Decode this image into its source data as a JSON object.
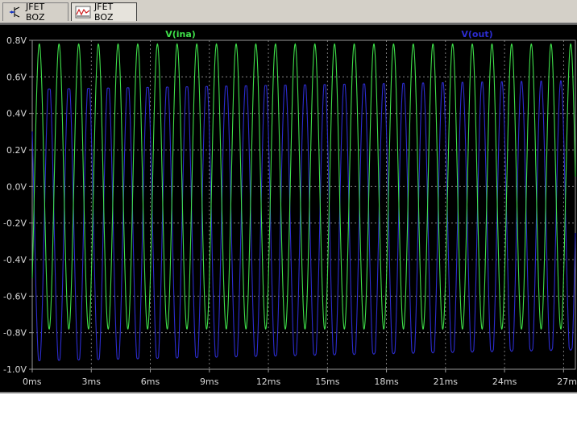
{
  "tabs": [
    {
      "label": "JFET BOZ",
      "icon": "schematic-icon"
    },
    {
      "label": "JFET BOZ",
      "icon": "waveform-icon"
    }
  ],
  "colors": {
    "background": "#000000",
    "grid": "#9a9a9a",
    "axis_text": "#d8d8d8",
    "tab_bg": "#d4d0c8"
  },
  "chart_data": {
    "type": "line",
    "x_unit": "ms",
    "y_unit": "V",
    "xlim": [
      0,
      27.6
    ],
    "ylim": [
      -1.0,
      0.8
    ],
    "x_ticks": [
      0,
      3,
      6,
      9,
      12,
      15,
      18,
      21,
      24,
      27
    ],
    "x_tick_labels": [
      "0ms",
      "3ms",
      "6ms",
      "9ms",
      "12ms",
      "15ms",
      "18ms",
      "21ms",
      "24ms",
      "27m"
    ],
    "y_ticks": [
      0.8,
      0.6,
      0.4,
      0.2,
      0.0,
      -0.2,
      -0.4,
      -0.6,
      -0.8,
      -1.0
    ],
    "y_tick_labels": [
      "0.8V",
      "0.6V",
      "0.4V",
      "0.2V",
      "0.0V",
      "-0.2V",
      "-0.4V",
      "-0.6V",
      "-0.8V",
      "-1.0V"
    ],
    "grid": true,
    "series": [
      {
        "name": "V(ina)",
        "color": "#3fe04a",
        "waveform": "sine",
        "frequency_hz": 1000,
        "amplitude_v": 0.78,
        "offset_v": 0.0,
        "start_phase_deg": -40
      },
      {
        "name": "V(out)",
        "color": "#2c2cd0",
        "waveform": "clipped-sine",
        "frequency_hz": 1000,
        "offset_v": -0.2,
        "amplitude_v": 0.78,
        "peak_v_start": 0.53,
        "peak_v_end": 0.58,
        "trough_v_start": -0.95,
        "trough_v_end": -0.88,
        "start_phase_deg": 140
      }
    ]
  }
}
